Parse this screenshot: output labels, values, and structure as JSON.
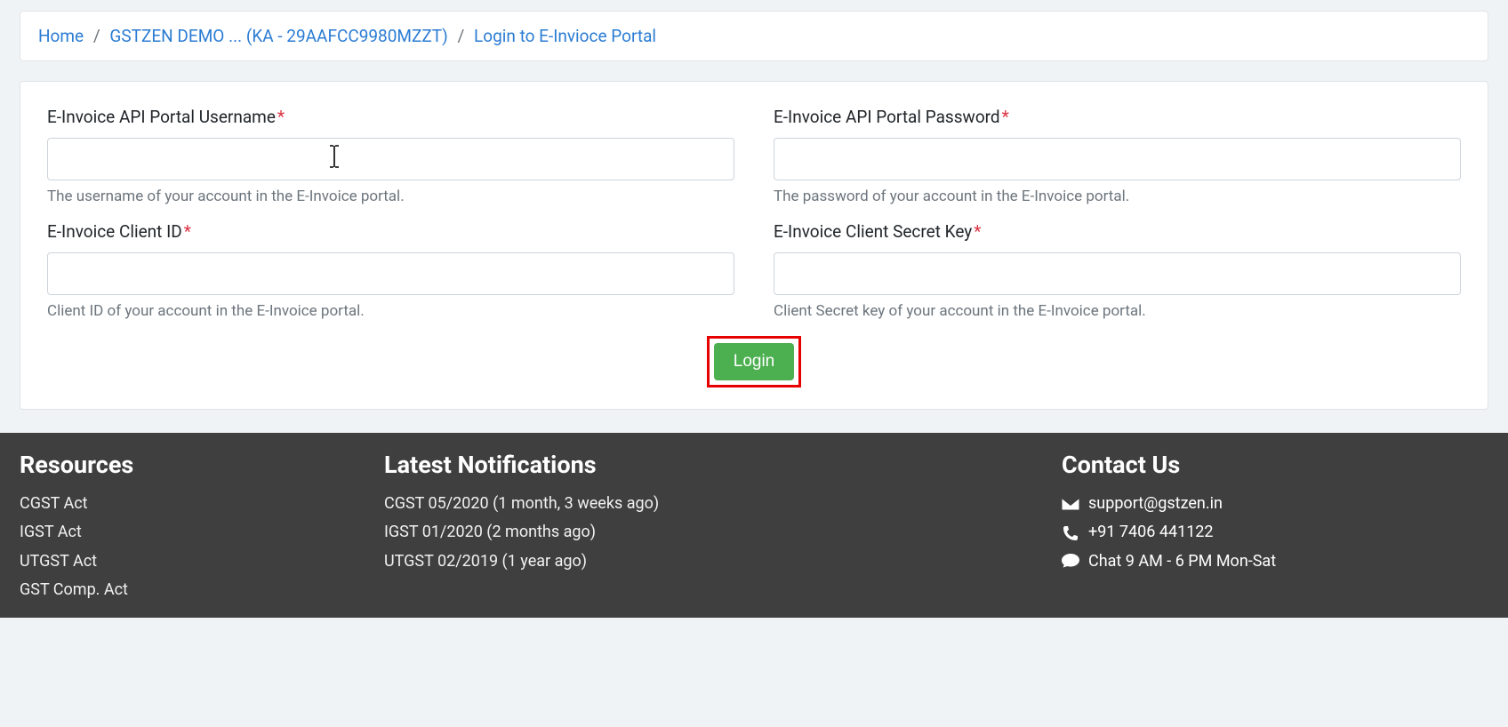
{
  "breadcrumb": {
    "home": "Home",
    "company": "GSTZEN DEMO ... (KA - 29AAFCC9980MZZT)",
    "current": "Login to E-Invioce Portal"
  },
  "form": {
    "username": {
      "label": "E-Invoice API Portal Username",
      "value": "",
      "help": "The username of your account in the E-Invoice portal."
    },
    "password": {
      "label": "E-Invoice API Portal Password",
      "value": "",
      "help": "The password of your account in the E-Invoice portal."
    },
    "client_id": {
      "label": "E-Invoice Client ID",
      "value": "",
      "help": "Client ID of your account in the E-Invoice portal."
    },
    "client_secret": {
      "label": "E-Invoice Client Secret Key",
      "value": "",
      "help": "Client Secret key of your account in the E-Invoice portal."
    },
    "login_label": "Login"
  },
  "footer": {
    "resources": {
      "heading": "Resources",
      "items": [
        "CGST Act",
        "IGST Act",
        "UTGST Act",
        "GST Comp. Act"
      ]
    },
    "notifications": {
      "heading": "Latest Notifications",
      "items": [
        "CGST 05/2020 (1 month, 3 weeks ago)",
        "IGST 01/2020 (2 months ago)",
        "UTGST 02/2019 (1 year ago)"
      ]
    },
    "contact": {
      "heading": "Contact Us",
      "email": "support@gstzen.in",
      "phone": "+91 7406 441122",
      "chat": "Chat 9 AM - 6 PM Mon-Sat"
    }
  }
}
